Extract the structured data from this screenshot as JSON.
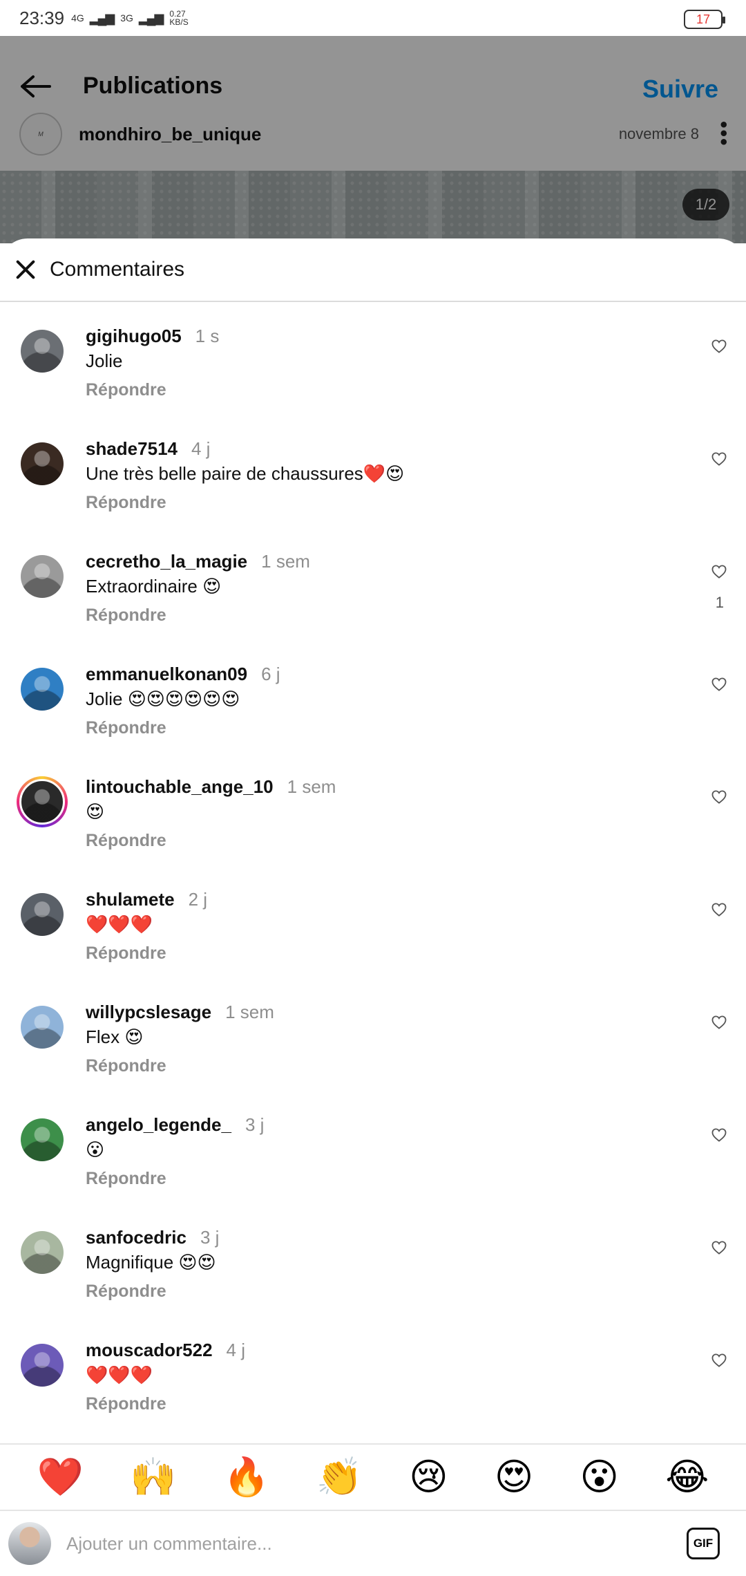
{
  "status_bar": {
    "time": "23:39",
    "network": "4G",
    "network2": "3G",
    "speed": "0.27",
    "speed_unit": "KB/S",
    "battery": "17"
  },
  "post": {
    "title": "Publications",
    "follow_label": "Suivre",
    "username": "mondhiro_be_unique",
    "date": "novembre 8",
    "page_indicator": "1/2"
  },
  "comments_sheet": {
    "title": "Commentaires",
    "reply_label": "Répondre",
    "items": [
      {
        "user": "gigihugo05",
        "time": "1 s",
        "text": "Jolie",
        "likes": "",
        "avatar_color": "#6b6f74"
      },
      {
        "user": "shade7514",
        "time": "4 j",
        "text": "Une très belle paire de chaussures❤️😍",
        "likes": "",
        "avatar_color": "#3a2a22"
      },
      {
        "user": "cecretho_la_magie",
        "time": "1 sem",
        "text": "Extraordinaire 😍",
        "likes": "1",
        "avatar_color": "#9a9a9a"
      },
      {
        "user": "emmanuelkonan09",
        "time": "6 j",
        "text": "Jolie 😍😍😍😍😍😍",
        "likes": "",
        "avatar_color": "#2f7fc4"
      },
      {
        "user": "lintouchable_ange_10",
        "time": "1 sem",
        "text": "😍",
        "likes": "",
        "avatar_color": "#2a2a2a"
      },
      {
        "user": "shulamete",
        "time": "2 j",
        "text": "❤️❤️❤️",
        "likes": "",
        "avatar_color": "#5a6068"
      },
      {
        "user": "willypcslesage",
        "time": "1 sem",
        "text": "Flex 😍",
        "likes": "",
        "avatar_color": "#8fb3d9"
      },
      {
        "user": "angelo_legende_",
        "time": "3 j",
        "text": "😮",
        "likes": "",
        "avatar_color": "#3d8f4a"
      },
      {
        "user": "sanfocedric",
        "time": "3 j",
        "text": "Magnifique 😍😍",
        "likes": "",
        "avatar_color": "#a8b7a0"
      },
      {
        "user": "mouscador522",
        "time": "4 j",
        "text": "❤️❤️❤️",
        "likes": "",
        "avatar_color": "#6c5bb8"
      }
    ]
  },
  "emoji_bar": [
    "❤️",
    "🙌",
    "🔥",
    "👏",
    "😢",
    "😍",
    "😮",
    "😂"
  ],
  "input": {
    "placeholder": "Ajouter un commentaire...",
    "gif_label": "GIF"
  },
  "colors": {
    "accent": "#0095f6",
    "muted": "#8e8e8e"
  }
}
